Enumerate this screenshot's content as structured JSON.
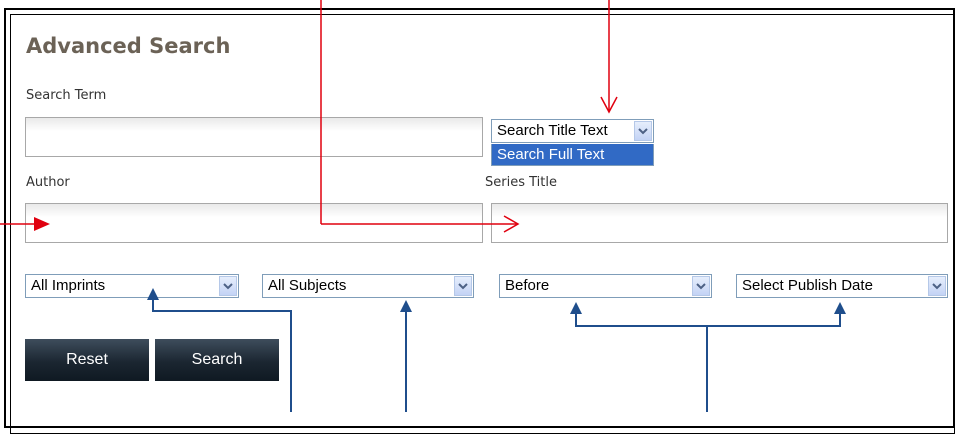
{
  "form": {
    "title": "Advanced Search",
    "search_term_label": "Search Term",
    "author_label": "Author",
    "series_title_label": "Series Title",
    "search_scope": {
      "selected": "Search Title Text",
      "highlighted_option": "Search Full Text"
    },
    "imprints": {
      "selected": "All Imprints"
    },
    "subjects": {
      "selected": "All Subjects"
    },
    "date_relation": {
      "selected": "Before"
    },
    "publish_date": {
      "selected": "Select Publish Date"
    },
    "buttons": {
      "reset": "Reset",
      "search": "Search"
    }
  },
  "colors": {
    "title": "#6b6256",
    "annotation_red": "#e0000f",
    "annotation_blue": "#1f4e8c",
    "button_dark": "#1b2631",
    "highlight": "#316ac5"
  }
}
